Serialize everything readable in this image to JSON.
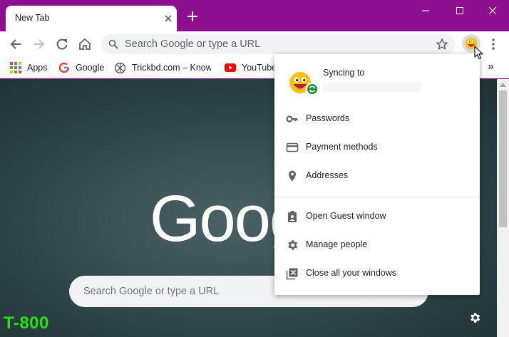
{
  "tab": {
    "title": "New Tab"
  },
  "omnibox": {
    "placeholder": "Search Google or type a URL"
  },
  "bookmarks": [
    {
      "label": "Apps",
      "icon": "apps-grid-icon"
    },
    {
      "label": "Google",
      "icon": "google-g-icon"
    },
    {
      "label": "Trickbd.com – Know f",
      "icon": "trickbd-icon"
    },
    {
      "label": "YouTube",
      "icon": "youtube-icon"
    }
  ],
  "page": {
    "logo": "Goog",
    "search_placeholder": "Search Google or type a URL",
    "watermark": "T-800"
  },
  "profile_menu": {
    "sync_label": "Syncing to",
    "items": [
      {
        "label": "Passwords",
        "icon": "key-icon"
      },
      {
        "label": "Payment methods",
        "icon": "credit-card-icon"
      },
      {
        "label": "Addresses",
        "icon": "location-pin-icon"
      },
      {
        "label": "Open Guest window",
        "icon": "guest-badge-icon"
      },
      {
        "label": "Manage people",
        "icon": "gear-icon"
      },
      {
        "label": "Close all your windows",
        "icon": "close-windows-icon"
      }
    ]
  },
  "colors": {
    "frame": "#8e0f8e",
    "sync_green": "#1e8e3e",
    "watermark": "#27e01b"
  }
}
